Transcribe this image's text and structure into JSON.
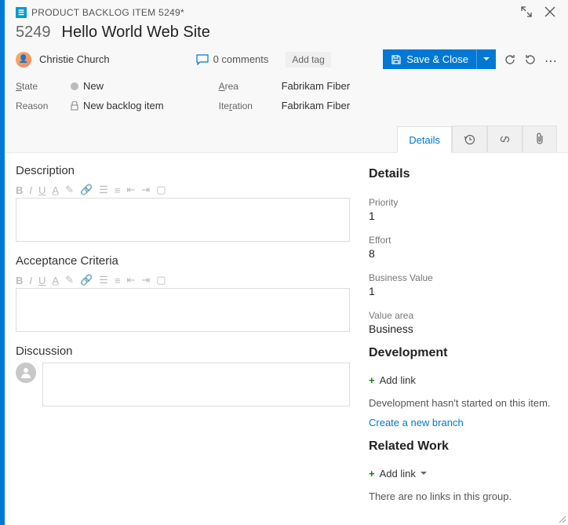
{
  "breadcrumb": {
    "icon": "≡",
    "text": "PRODUCT BACKLOG ITEM 5249*"
  },
  "title": {
    "id": "5249",
    "text": "Hello World Web Site"
  },
  "person": {
    "name": "Christie Church"
  },
  "comments": {
    "count": "0 comments"
  },
  "addTag": "Add tag",
  "save": "Save & Close",
  "fields": {
    "stateLabel": "State",
    "stateValue": "New",
    "reasonLabel": "Reason",
    "reasonValue": "New backlog item",
    "areaLabel": "Area",
    "areaValue": "Fabrikam Fiber",
    "iterationLabel": "Iteration",
    "iterationValue": "Fabrikam Fiber"
  },
  "tabs": {
    "details": "Details"
  },
  "leftSections": {
    "description": "Description",
    "acceptance": "Acceptance Criteria",
    "discussion": "Discussion"
  },
  "rightPanel": {
    "detailsHeader": "Details",
    "priorityLabel": "Priority",
    "priorityValue": "1",
    "effortLabel": "Effort",
    "effortValue": "8",
    "bvLabel": "Business Value",
    "bvValue": "1",
    "vaLabel": "Value area",
    "vaValue": "Business",
    "devHeader": "Development",
    "addLink": "Add link",
    "devEmpty": "Development hasn't started on this item.",
    "createBranch": "Create a new branch",
    "relatedHeader": "Related Work",
    "relatedEmpty": "There are no links in this group."
  }
}
